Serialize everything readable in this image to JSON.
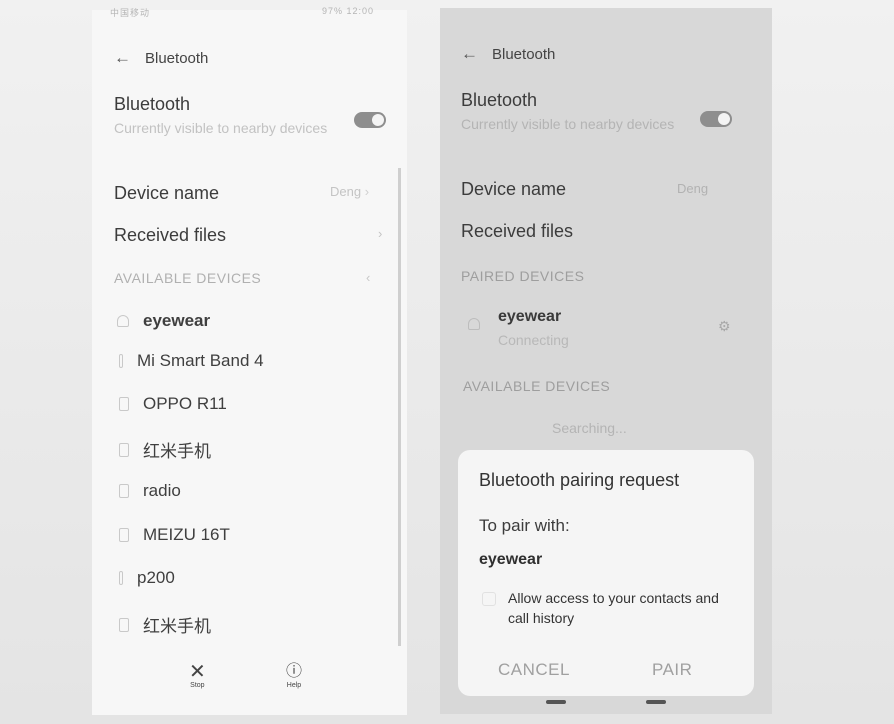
{
  "left": {
    "status_left": "中国移动",
    "status_right": "97% 12:00",
    "header_title": "Bluetooth",
    "bluetooth": {
      "title": "Bluetooth",
      "subtitle": "Currently visible to nearby devices",
      "toggle_on": true
    },
    "device_name": {
      "label": "Device name",
      "value": "Deng"
    },
    "received_files": {
      "label": "Received files"
    },
    "available_section": "AVAILABLE DEVICES",
    "devices": [
      {
        "name": "eyewear",
        "icon": "headset-icon",
        "bold": true
      },
      {
        "name": "Mi Smart Band 4",
        "icon": "band-icon",
        "bold": false
      },
      {
        "name": "OPPO R11",
        "icon": "phone-icon",
        "bold": false
      },
      {
        "name": "红米手机",
        "icon": "phone-icon",
        "bold": false
      },
      {
        "name": "radio",
        "icon": "phone-icon",
        "bold": false
      },
      {
        "name": "MEIZU 16T",
        "icon": "phone-icon",
        "bold": false
      },
      {
        "name": "p200",
        "icon": "band-icon",
        "bold": false
      },
      {
        "name": "红米手机",
        "icon": "phone-icon",
        "bold": false
      }
    ],
    "bottom": {
      "stop_label": "Stop",
      "help_label": "Help"
    }
  },
  "right": {
    "header_title": "Bluetooth",
    "bluetooth": {
      "title": "Bluetooth",
      "subtitle": "Currently visible to nearby devices",
      "toggle_on": true
    },
    "device_name": {
      "label": "Device name",
      "value": "Deng"
    },
    "received_files": {
      "label": "Received files"
    },
    "paired_section": "PAIRED DEVICES",
    "paired_device": {
      "name": "eyewear",
      "status": "Connecting"
    },
    "available_section": "AVAILABLE DEVICES",
    "searching": "Searching...",
    "dialog": {
      "title": "Bluetooth pairing request",
      "to_pair": "To pair with:",
      "device": "eyewear",
      "allow_text": "Allow access to your contacts and call history",
      "cancel": "CANCEL",
      "pair": "PAIR"
    }
  }
}
